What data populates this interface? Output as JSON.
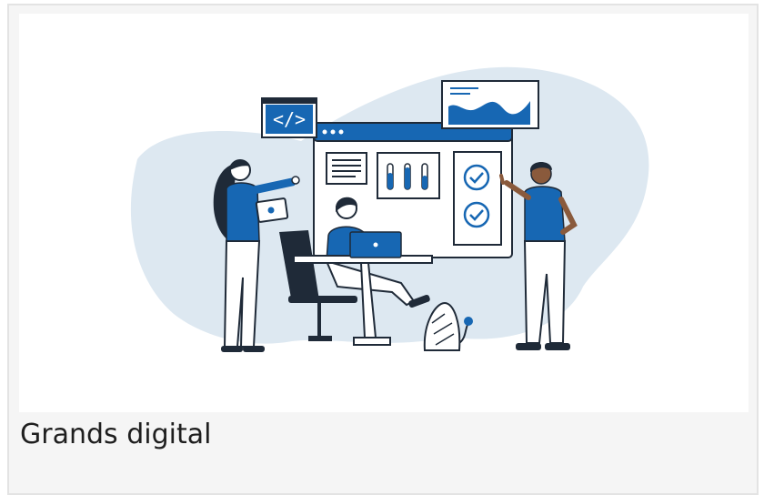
{
  "card": {
    "title": "Grands digital"
  },
  "illustration": {
    "code_badge_text": "</>",
    "colors": {
      "accent": "#1767b3",
      "background_blob": "#dde8f1",
      "outline": "#1f2a38",
      "panel": "#ffffff",
      "card_bg": "#f5f5f5"
    }
  }
}
